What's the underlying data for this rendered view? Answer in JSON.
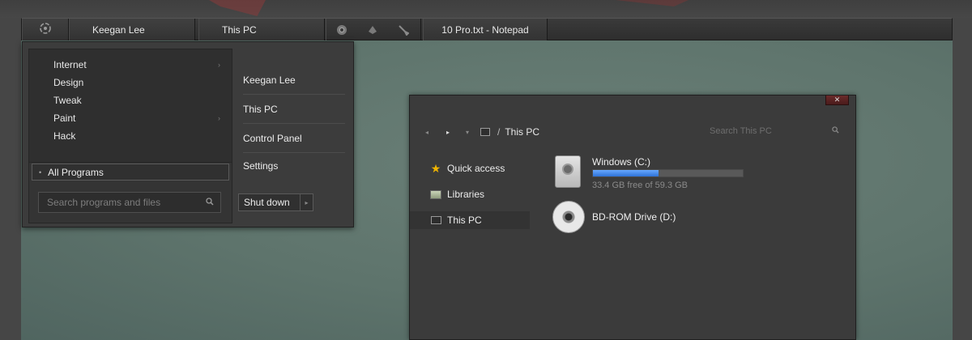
{
  "colors": {
    "accent": "#2e72d8",
    "taskbar_bg": "#2e2e2e",
    "menu_bg": "#3c3c3c",
    "window_bg": "#3b3b3b",
    "desktop_bg": "#5e746c",
    "close_button": "#6a2a2a",
    "star_icon": "#f0b400"
  },
  "taskbar": {
    "start_icon": "start-orb-icon",
    "user_button": "Keegan Lee",
    "thispc_button": "This PC",
    "pinned_icons": [
      "chrome-icon",
      "paint-icon",
      "brush-icon"
    ],
    "notepad_button": "10 Pro.txt - Notepad"
  },
  "start_menu": {
    "programs": [
      {
        "label": "Internet",
        "has_submenu": true
      },
      {
        "label": "Design",
        "has_submenu": false
      },
      {
        "label": "Tweak",
        "has_submenu": false
      },
      {
        "label": "Paint",
        "has_submenu": true
      },
      {
        "label": "Hack",
        "has_submenu": false
      }
    ],
    "all_programs": "All Programs",
    "search_placeholder": "Search programs and files",
    "right_items": [
      "Keegan Lee",
      "This PC",
      "Control Panel",
      "Settings"
    ],
    "shutdown_label": "Shut down"
  },
  "explorer": {
    "address": {
      "separator": "/",
      "location": "This PC"
    },
    "search_placeholder": "Search This PC",
    "nav_pane": [
      {
        "label": "Quick access",
        "icon": "star-icon",
        "selected": false
      },
      {
        "label": "Libraries",
        "icon": "libraries-icon",
        "selected": false
      },
      {
        "label": "This PC",
        "icon": "computer-icon",
        "selected": true
      }
    ],
    "drives": [
      {
        "name": "Windows (C:)",
        "icon": "hard-drive-icon",
        "used_fraction": 0.44,
        "free_text": "33.4 GB free of 59.3 GB"
      },
      {
        "name": "BD-ROM Drive (D:)",
        "icon": "disc-drive-icon"
      }
    ]
  }
}
